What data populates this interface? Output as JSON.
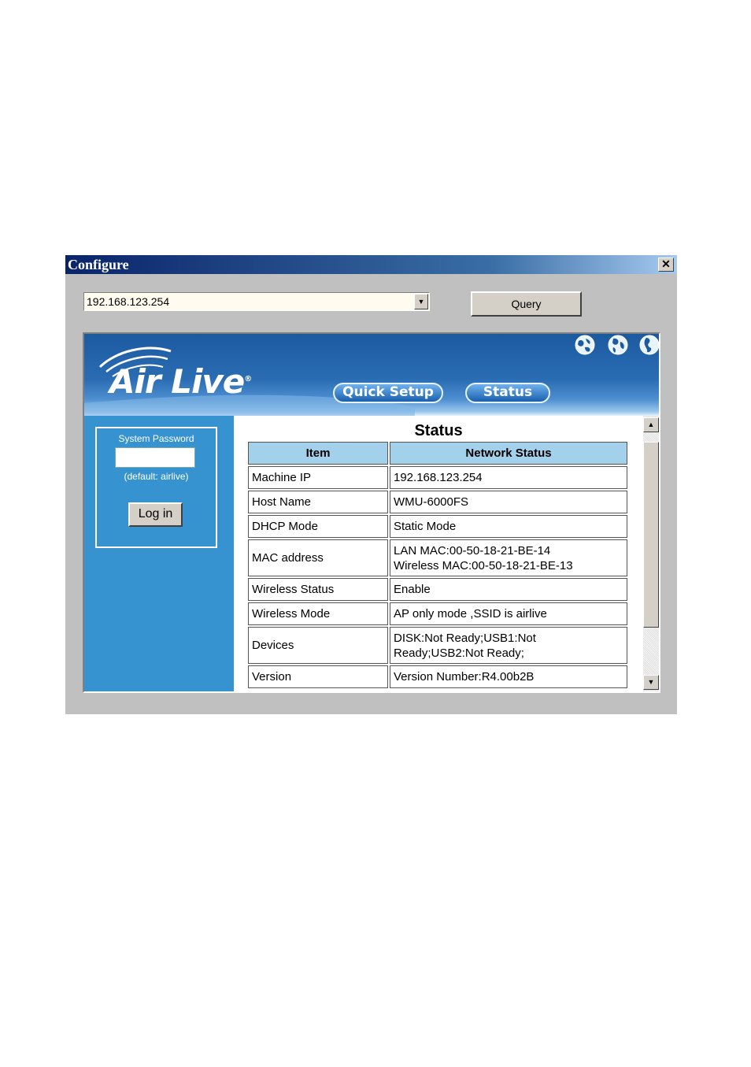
{
  "window": {
    "title": "Configure",
    "close_icon": "close-icon"
  },
  "toolbar": {
    "address_value": "192.168.123.254",
    "query_label": "Query"
  },
  "banner": {
    "logo_text": "Air Live",
    "logo_mark": "®",
    "nav": [
      {
        "label": "Quick Setup"
      },
      {
        "label": "Status"
      }
    ],
    "icons": [
      "globe-icon",
      "globe-icon",
      "globe-icon"
    ]
  },
  "login": {
    "label": "System Password",
    "password_value": "",
    "hint": "(default: airlive)",
    "button_label": "Log in"
  },
  "status": {
    "title": "Status",
    "headers": [
      "Item",
      "Network Status"
    ],
    "rows": [
      {
        "item": "Machine IP",
        "value": "192.168.123.254"
      },
      {
        "item": "Host Name",
        "value": "WMU-6000FS"
      },
      {
        "item": "DHCP Mode",
        "value": "Static Mode"
      },
      {
        "item": "MAC address",
        "value": "LAN MAC:00-50-18-21-BE-14",
        "value2": "Wireless MAC:00-50-18-21-BE-13"
      },
      {
        "item": "Wireless Status",
        "value": "Enable"
      },
      {
        "item": "Wireless Mode",
        "value": "AP only mode ,SSID is airlive"
      },
      {
        "item": "Devices",
        "value": "DISK:Not Ready;USB1:Not",
        "value2": "Ready;USB2:Not Ready;"
      },
      {
        "item": "Version",
        "value": "Version Number:R4.00b2B"
      }
    ]
  },
  "colors": {
    "titlebar": "#0a246a",
    "banner": "#1c5aa0",
    "sidebar": "#3793cf",
    "table_header": "#a3d0ea"
  }
}
